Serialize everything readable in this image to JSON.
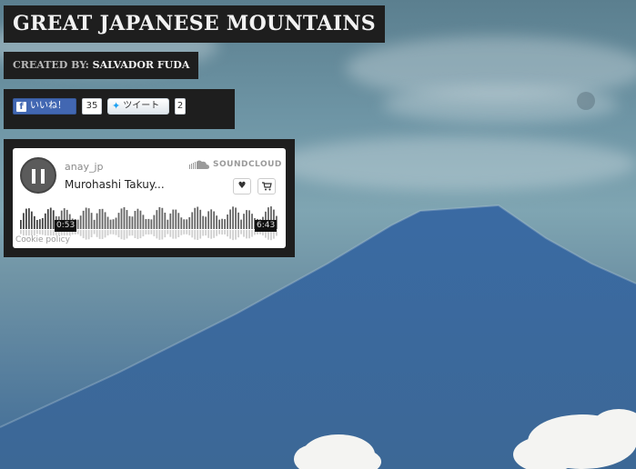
{
  "page": {
    "title": "GREAT JAPANESE MOUNTAINS",
    "byline_label": "CREATED BY:",
    "byline_name": "SALVADOR FUDA"
  },
  "social": {
    "facebook_label": "いいね！",
    "facebook_icon": "facebook-icon",
    "facebook_count": "35",
    "twitter_label": "ツイート",
    "twitter_icon": "twitter-bird-icon",
    "twitter_count": "2"
  },
  "player": {
    "artist": "anay_jp",
    "track": "Murohashi Takuy...",
    "brand": "SOUNDCLOUD",
    "time_elapsed": "0:53",
    "time_total": "6:43",
    "cookie_policy": "Cookie policy",
    "state": "playing",
    "progress": 0.13
  },
  "colors": {
    "panel": "#1e1e1e",
    "facebook": "#4267b2",
    "twitter": "#1da1f2"
  }
}
